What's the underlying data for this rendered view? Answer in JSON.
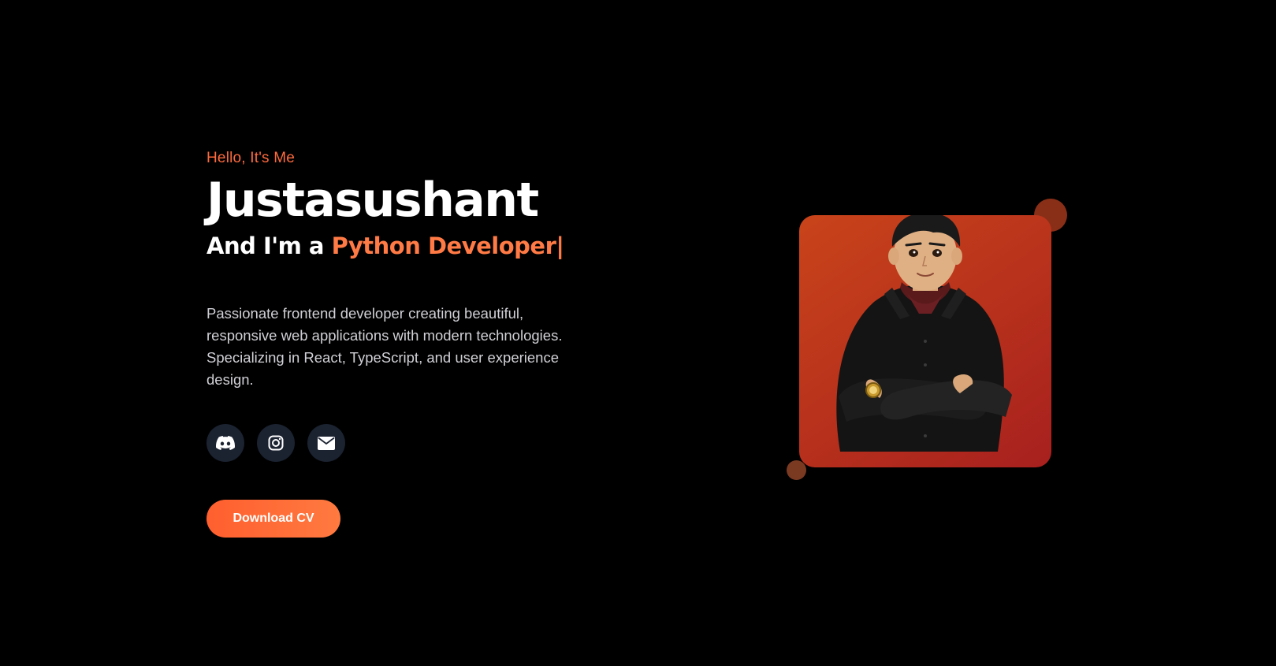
{
  "hero": {
    "greeting": "Hello, It's Me",
    "name": "Justasushant",
    "role_prefix": "And I'm a ",
    "role": "Python Developer",
    "cursor": "|",
    "bio": "Passionate frontend developer creating beautiful, responsive web applications with modern technologies. Specializing in React, TypeScript, and user experience design."
  },
  "socials": [
    {
      "icon": "discord-icon"
    },
    {
      "icon": "instagram-icon"
    },
    {
      "icon": "mail-icon"
    }
  ],
  "cta": {
    "download_cv_label": "Download CV"
  },
  "colors": {
    "background": "#000000",
    "accent": "#ff6a3d",
    "social_bg": "#1b2230",
    "card_gradient_start": "#c9441a",
    "card_gradient_end": "#a8201e"
  }
}
